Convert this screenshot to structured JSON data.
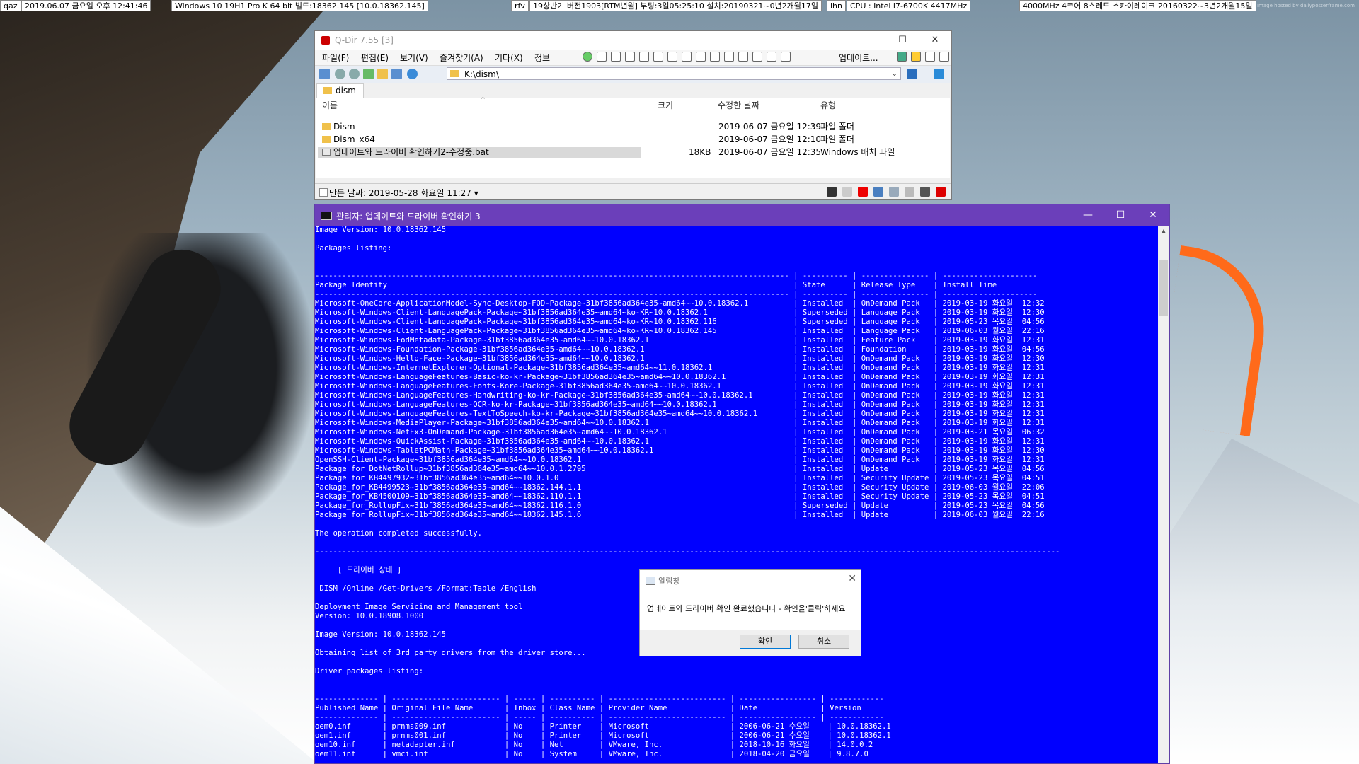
{
  "infobar": {
    "items": [
      "qaz",
      "2019.06.07 금요일 오후 12:41:46",
      "Windows 10 19H1 Pro K 64 bit 빌드:18362.145 [10.0.18362.145]",
      "rfv",
      "19상반기 버전1903[RTM년월] 부팅:3일05:25:10 설치:20190321~0년2개월17일",
      "ihn",
      "CPU : Intel i7-6700K 4417MHz",
      "4000MHz 4코어 8스레드 스카이레이크 20160322~3년2개월15일"
    ]
  },
  "wallpaper": {
    "watermark": "Image hosted by dailyposterframe.com"
  },
  "qdir": {
    "title": "Q-Dir 7.55 [3]",
    "menu": [
      "파일(F)",
      "편집(E)",
      "보기(V)",
      "즐겨찾기(A)",
      "기타(X)",
      "정보"
    ],
    "update_label": "업데이트...",
    "address": "K:\\dism\\",
    "tab": "dism",
    "columns": {
      "name": "이름",
      "size": "크기",
      "modified": "수정한 날짜",
      "type": "유형"
    },
    "files": [
      {
        "name": "Dism",
        "size": "",
        "modified": "2019-06-07 금요일 12:39",
        "type": "파일 폴더",
        "kind": "folder"
      },
      {
        "name": "Dism_x64",
        "size": "",
        "modified": "2019-06-07 금요일 12:10",
        "type": "파일 폴더",
        "kind": "folder"
      },
      {
        "name": "업데이트와 드라이버 확인하기2-수정중.bat",
        "size": "18KB",
        "modified": "2019-06-07 금요일 12:35",
        "type": "Windows 배치 파일",
        "kind": "bat"
      }
    ],
    "status": "만든 날짜: 2019-05-28 화요일 11:27 ▾"
  },
  "cmd": {
    "title": "관리자: 업데이트와 드라이버 확인하기 3",
    "image_version": "Image Version: 10.0.18362.145",
    "packages_listing": "Packages listing:",
    "pkg_headers": {
      "identity": "Package Identity",
      "state": "State",
      "release": "Release Type",
      "install": "Install Time"
    },
    "packages": [
      [
        "Microsoft-OneCore-ApplicationModel-Sync-Desktop-FOD-Package~31bf3856ad364e35~amd64~~10.0.18362.1",
        "Installed",
        "OnDemand Pack",
        "2019-03-19 화요일  12:32"
      ],
      [
        "Microsoft-Windows-Client-LanguagePack-Package~31bf3856ad364e35~amd64~ko-KR~10.0.18362.1",
        "Superseded",
        "Language Pack",
        "2019-03-19 화요일  12:30"
      ],
      [
        "Microsoft-Windows-Client-LanguagePack-Package~31bf3856ad364e35~amd64~ko-KR~10.0.18362.116",
        "Superseded",
        "Language Pack",
        "2019-05-23 목요일  04:56"
      ],
      [
        "Microsoft-Windows-Client-LanguagePack-Package~31bf3856ad364e35~amd64~ko-KR~10.0.18362.145",
        "Installed",
        "Language Pack",
        "2019-06-03 월요일  22:16"
      ],
      [
        "Microsoft-Windows-FodMetadata-Package~31bf3856ad364e35~amd64~~10.0.18362.1",
        "Installed",
        "Feature Pack",
        "2019-03-19 화요일  12:31"
      ],
      [
        "Microsoft-Windows-Foundation-Package~31bf3856ad364e35~amd64~~10.0.18362.1",
        "Installed",
        "Foundation",
        "2019-03-19 화요일  04:56"
      ],
      [
        "Microsoft-Windows-Hello-Face-Package~31bf3856ad364e35~amd64~~10.0.18362.1",
        "Installed",
        "OnDemand Pack",
        "2019-03-19 화요일  12:30"
      ],
      [
        "Microsoft-Windows-InternetExplorer-Optional-Package~31bf3856ad364e35~amd64~~11.0.18362.1",
        "Installed",
        "OnDemand Pack",
        "2019-03-19 화요일  12:31"
      ],
      [
        "Microsoft-Windows-LanguageFeatures-Basic-ko-kr-Package~31bf3856ad364e35~amd64~~10.0.18362.1",
        "Installed",
        "OnDemand Pack",
        "2019-03-19 화요일  12:31"
      ],
      [
        "Microsoft-Windows-LanguageFeatures-Fonts-Kore-Package~31bf3856ad364e35~amd64~~10.0.18362.1",
        "Installed",
        "OnDemand Pack",
        "2019-03-19 화요일  12:31"
      ],
      [
        "Microsoft-Windows-LanguageFeatures-Handwriting-ko-kr-Package~31bf3856ad364e35~amd64~~10.0.18362.1",
        "Installed",
        "OnDemand Pack",
        "2019-03-19 화요일  12:31"
      ],
      [
        "Microsoft-Windows-LanguageFeatures-OCR-ko-kr-Package~31bf3856ad364e35~amd64~~10.0.18362.1",
        "Installed",
        "OnDemand Pack",
        "2019-03-19 화요일  12:31"
      ],
      [
        "Microsoft-Windows-LanguageFeatures-TextToSpeech-ko-kr-Package~31bf3856ad364e35~amd64~~10.0.18362.1",
        "Installed",
        "OnDemand Pack",
        "2019-03-19 화요일  12:31"
      ],
      [
        "Microsoft-Windows-MediaPlayer-Package~31bf3856ad364e35~amd64~~10.0.18362.1",
        "Installed",
        "OnDemand Pack",
        "2019-03-19 화요일  12:31"
      ],
      [
        "Microsoft-Windows-NetFx3-OnDemand-Package~31bf3856ad364e35~amd64~~10.0.18362.1",
        "Installed",
        "OnDemand Pack",
        "2019-03-21 목요일  06:32"
      ],
      [
        "Microsoft-Windows-QuickAssist-Package~31bf3856ad364e35~amd64~~10.0.18362.1",
        "Installed",
        "OnDemand Pack",
        "2019-03-19 화요일  12:31"
      ],
      [
        "Microsoft-Windows-TabletPCMath-Package~31bf3856ad364e35~amd64~~10.0.18362.1",
        "Installed",
        "OnDemand Pack",
        "2019-03-19 화요일  12:30"
      ],
      [
        "OpenSSH-Client-Package~31bf3856ad364e35~amd64~~10.0.18362.1",
        "Installed",
        "OnDemand Pack",
        "2019-03-19 화요일  12:31"
      ],
      [
        "Package_for_DotNetRollup~31bf3856ad364e35~amd64~~10.0.1.2795",
        "Installed",
        "Update",
        "2019-05-23 목요일  04:56"
      ],
      [
        "Package_for_KB4497932~31bf3856ad364e35~amd64~~10.0.1.0",
        "Installed",
        "Security Update",
        "2019-05-23 목요일  04:51"
      ],
      [
        "Package_for_KB4499523~31bf3856ad364e35~amd64~~18362.144.1.1",
        "Installed",
        "Security Update",
        "2019-06-03 월요일  22:06"
      ],
      [
        "Package_for_KB4500109~31bf3856ad364e35~amd64~~18362.110.1.1",
        "Installed",
        "Security Update",
        "2019-05-23 목요일  04:51"
      ],
      [
        "Package_for_RollupFix~31bf3856ad364e35~amd64~~18362.116.1.0",
        "Superseded",
        "Update",
        "2019-05-23 목요일  04:56"
      ],
      [
        "Package_for_RollupFix~31bf3856ad364e35~amd64~~18362.145.1.6",
        "Installed",
        "Update",
        "2019-06-03 월요일  22:16"
      ]
    ],
    "op_success": "The operation completed successfully.",
    "driver_heading": "[ 드라이버 상태 ]",
    "driver_cmd": " DISM /Online /Get-Drivers /Format:Table /English",
    "dism_tool": "Deployment Image Servicing and Management tool",
    "dism_version": "Version: 10.0.18908.1000",
    "image_version2": "Image Version: 10.0.18362.145",
    "obtaining": "Obtaining list of 3rd party drivers from the driver store...",
    "driver_listing": "Driver packages listing:",
    "drv_headers": {
      "published": "Published Name",
      "original": "Original File Name",
      "inbox": "Inbox",
      "class": "Class Name",
      "provider": "Provider Name",
      "date": "Date",
      "version": "Version"
    },
    "drivers": [
      [
        "oem0.inf",
        "prnms009.inf",
        "No",
        "Printer",
        "Microsoft",
        "2006-06-21 수요일",
        "10.0.18362.1"
      ],
      [
        "oem1.inf",
        "prnms001.inf",
        "No",
        "Printer",
        "Microsoft",
        "2006-06-21 수요일",
        "10.0.18362.1"
      ],
      [
        "oem10.inf",
        "netadapter.inf",
        "No",
        "Net",
        "VMware, Inc.",
        "2018-10-16 화요일",
        "14.0.0.2"
      ],
      [
        "oem11.inf",
        "vmci.inf",
        "No",
        "System",
        "VMware, Inc.",
        "2018-04-20 금요일",
        "9.8.7.0"
      ]
    ]
  },
  "dialog": {
    "title": "알림창",
    "message": "업데이트와 드라이버 확인 완료했습니다 - 확인을'클릭'하세요",
    "ok": "확인",
    "cancel": "취소"
  }
}
